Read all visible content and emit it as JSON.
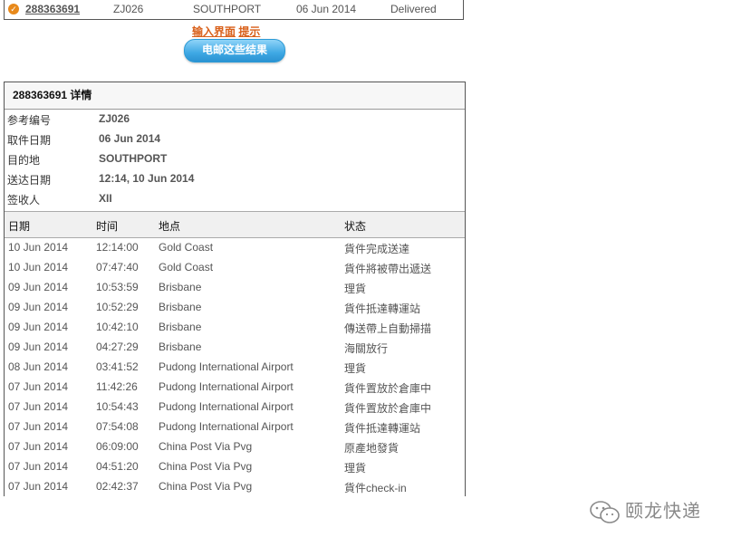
{
  "summary": {
    "tracking_number": "288363691",
    "reference": "ZJ026",
    "destination": "SOUTHPORT",
    "date": "06 Jun 2014",
    "status": "Delivered"
  },
  "links": {
    "input_view": "输入界面",
    "tips": "提示"
  },
  "email_button": "电邮这些结果",
  "details": {
    "title": "288363691 详情",
    "info": [
      {
        "label": "参考编号",
        "value": "ZJ026"
      },
      {
        "label": "取件日期",
        "value": "06 Jun 2014"
      },
      {
        "label": "目的地",
        "value": "SOUTHPORT"
      },
      {
        "label": "送达日期",
        "value": "12:14, 10 Jun 2014"
      },
      {
        "label": "签收人",
        "value": "XII"
      }
    ],
    "columns": {
      "date": "日期",
      "time": "时间",
      "location": "地点",
      "status": "状态"
    },
    "events": [
      {
        "date": "10 Jun 2014",
        "time": "12:14:00",
        "location": "Gold Coast",
        "status": "貨件完成送達"
      },
      {
        "date": "10 Jun 2014",
        "time": "07:47:40",
        "location": "Gold Coast",
        "status": "貨件將被帶出遞送"
      },
      {
        "date": "09 Jun 2014",
        "time": "10:53:59",
        "location": "Brisbane",
        "status": "理貨"
      },
      {
        "date": "09 Jun 2014",
        "time": "10:52:29",
        "location": "Brisbane",
        "status": "貨件抵達轉運站"
      },
      {
        "date": "09 Jun 2014",
        "time": "10:42:10",
        "location": "Brisbane",
        "status": "傳送帶上自動掃描"
      },
      {
        "date": "09 Jun 2014",
        "time": "04:27:29",
        "location": "Brisbane",
        "status": "海關放行"
      },
      {
        "date": "08 Jun 2014",
        "time": "03:41:52",
        "location": "Pudong International Airport",
        "status": "理貨"
      },
      {
        "date": "07 Jun 2014",
        "time": "11:42:26",
        "location": "Pudong International Airport",
        "status": "貨件置放於倉庫中"
      },
      {
        "date": "07 Jun 2014",
        "time": "10:54:43",
        "location": "Pudong International Airport",
        "status": "貨件置放於倉庫中"
      },
      {
        "date": "07 Jun 2014",
        "time": "07:54:08",
        "location": "Pudong International Airport",
        "status": "貨件抵達轉運站"
      },
      {
        "date": "07 Jun 2014",
        "time": "06:09:00",
        "location": "China Post Via Pvg",
        "status": "原產地發貨"
      },
      {
        "date": "07 Jun 2014",
        "time": "04:51:20",
        "location": "China Post Via Pvg",
        "status": "理貨"
      },
      {
        "date": "07 Jun 2014",
        "time": "02:42:37",
        "location": "China Post Via Pvg",
        "status": "貨件check-in"
      }
    ]
  },
  "watermark": {
    "text": "颐龙快递",
    "icon": "wechat-icon"
  }
}
